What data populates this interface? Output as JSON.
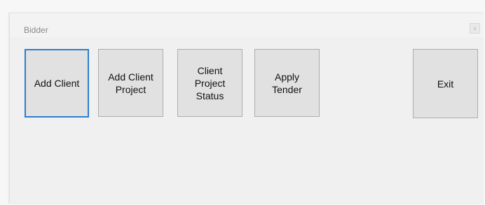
{
  "window": {
    "title": "Bidder",
    "close_glyph": "x"
  },
  "buttons": {
    "add_client": "Add Client",
    "add_client_project": "Add Client\nProject",
    "client_project_status": "Client\nProject\nStatus",
    "apply_tender": "Apply\nTender",
    "exit": "Exit"
  },
  "colors": {
    "focus_border": "#2a7fd0",
    "button_face": "#e1e1e1",
    "window_bg": "#f0f0f0"
  }
}
